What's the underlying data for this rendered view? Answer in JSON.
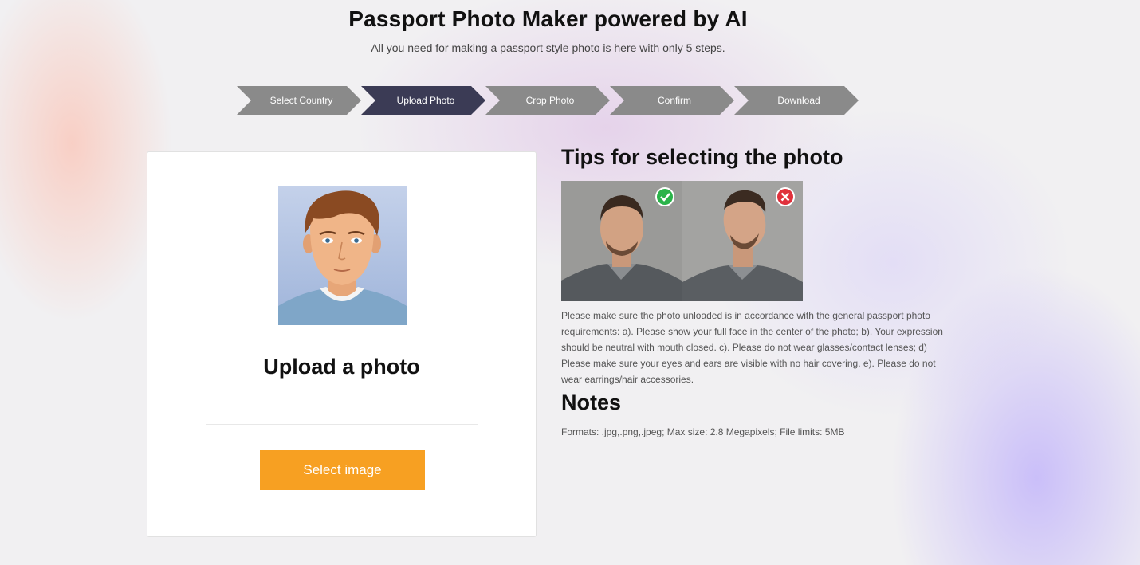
{
  "header": {
    "title": "Passport Photo Maker powered by AI",
    "subtitle": "All you need for making a passport style photo is here with only 5 steps."
  },
  "steps": [
    {
      "label": "Select Country",
      "active": false
    },
    {
      "label": "Upload Photo",
      "active": true
    },
    {
      "label": "Crop Photo",
      "active": false
    },
    {
      "label": "Confirm",
      "active": false
    },
    {
      "label": "Download",
      "active": false
    }
  ],
  "upload": {
    "title": "Upload a photo",
    "button_label": "Select image",
    "avatar_icon": "cartoon-person-icon"
  },
  "tips": {
    "title": "Tips for selecting the photo",
    "good_example_icon": "check-icon",
    "bad_example_icon": "cross-icon",
    "text": "Please make sure the photo unloaded is in accordance with the general passport photo requirements: a). Please show your full face in the center of the photo; b). Your expression should be neutral with mouth closed. c). Please do not wear glasses/contact lenses; d) Please make sure your eyes and ears are visible with no hair covering. e). Please do not wear earrings/hair accessories."
  },
  "notes": {
    "title": "Notes",
    "text": "Formats: .jpg,.png,.jpeg; Max size: 2.8 Megapixels; File limits: 5MB"
  },
  "colors": {
    "step_default": "#8a8a8a",
    "step_active": "#3b3b55",
    "button": "#f7a022",
    "good": "#2bb34a",
    "bad": "#e0313c"
  }
}
